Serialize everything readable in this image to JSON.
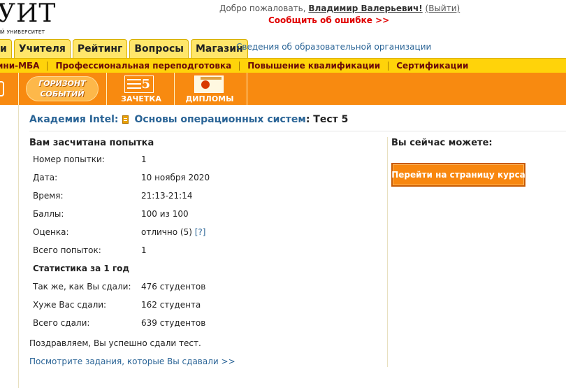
{
  "header": {
    "logo_text": "УИТ",
    "logo_sub": "ЙЙ УНИВЕРСИТЕТ",
    "welcome_prefix": "Добро пожаловать,",
    "user_name": "Владимир Валерьевич!",
    "logout_label": "(Выйти)",
    "report_error": "Сообщить об ошибке >>"
  },
  "tabs": [
    {
      "label": "и"
    },
    {
      "label": "Учителя"
    },
    {
      "label": "Рейтинг"
    },
    {
      "label": "Вопросы"
    },
    {
      "label": "Магазин"
    }
  ],
  "org_info_link": "Сведения об образовательной организации",
  "subnav": [
    {
      "label": "ини-МБА"
    },
    {
      "label": "Профессиональная переподготовка"
    },
    {
      "label": "Повышение квалификации"
    },
    {
      "label": "Сертификации"
    }
  ],
  "banner": {
    "horizon_line1": "ГОРИЗОНТ",
    "horizon_line2": "СОБЫТИЙ",
    "zachetka_number": "5",
    "zachetka_label": "ЗАЧЕТКА",
    "diplomas_label": "ДИПЛОМЫ"
  },
  "breadcrumb": {
    "academy": "Академия Intel",
    "academy_sep": ":",
    "course": "Основы операционных систем",
    "course_sep": ":",
    "test": "Тест 5"
  },
  "result": {
    "title": "Вам засчитана попытка",
    "rows": [
      {
        "key": "Номер попытки:",
        "value": "1"
      },
      {
        "key": "Дата:",
        "value": "10 ноября 2020"
      },
      {
        "key": "Время:",
        "value": "21:13-21:14"
      },
      {
        "key": "Баллы:",
        "value": "100 из 100"
      },
      {
        "key": "Оценка:",
        "value": "отлично (5)",
        "help": "[?]"
      },
      {
        "key": "Всего попыток:",
        "value": "1"
      }
    ],
    "stats_title": "Статистика за 1 год",
    "stats": [
      {
        "key": "Так же, как Вы сдали:",
        "value": "476 студентов"
      },
      {
        "key": "Хуже Вас сдали:",
        "value": "162 студента"
      },
      {
        "key": "Всего сдали:",
        "value": "639 студентов"
      }
    ],
    "congrats": "Поздравляем, Вы успешно сдали тест.",
    "tasks_link": "Посмотрите задания, которые Вы сдавали >>"
  },
  "sidebar": {
    "title": "Вы сейчас можете:",
    "course_button": "Перейти на страницу курса"
  }
}
